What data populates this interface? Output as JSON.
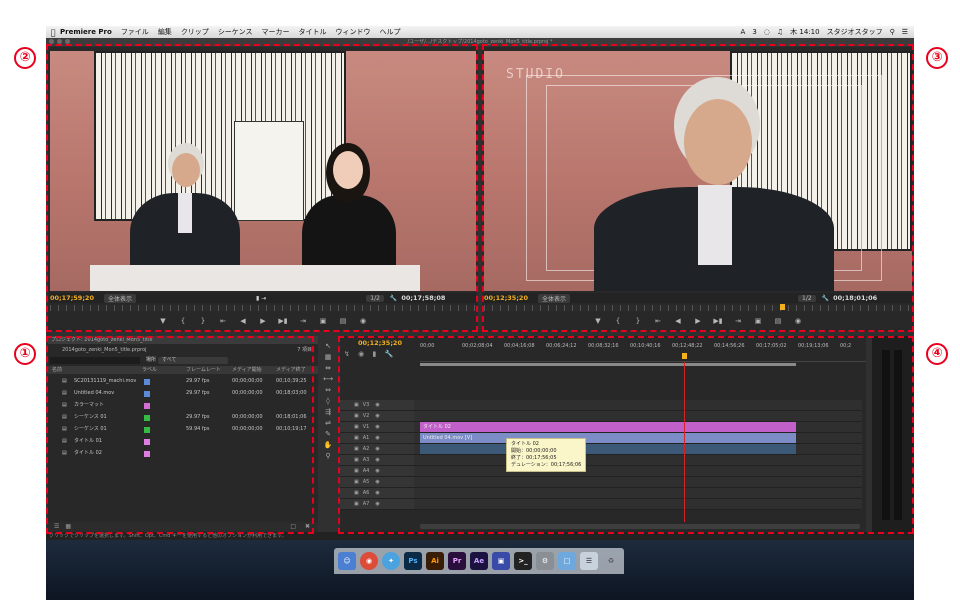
{
  "menubar": {
    "app_name": "Premiere Pro",
    "items": [
      "ファイル",
      "編集",
      "クリップ",
      "シーケンス",
      "マーカー",
      "タイトル",
      "ウィンドウ",
      "ヘルプ"
    ],
    "status": {
      "adobe": "3",
      "clock": "木 14:10",
      "user": "スタジオスタッフ"
    }
  },
  "window": {
    "title": "/ユーザ/.../デスクトップ/2014goto_zenki_Mon5_title.prproj *"
  },
  "source_monitor": {
    "timecode_in": "00;17;59;20",
    "fit": "全体表示",
    "resolution": "1/2",
    "timecode_out": "00;17;58;08"
  },
  "program_monitor": {
    "overlay_label": "STUDIO",
    "timecode_in": "00;12;35;20",
    "fit": "全体表示",
    "resolution": "1/2",
    "timecode_out": "00;18;01;06"
  },
  "project_panel": {
    "tab": "プロジェクト: 2014goto_zenki_Mon5_title",
    "file": "2014goto_zenki_Mon5_title.prproj",
    "count": "7 項目",
    "filter_label": "場所",
    "filter_value": "すべて",
    "columns": [
      "名前",
      "ラベル",
      "フレームレート",
      "メディア開始",
      "メディア終了"
    ],
    "rows": [
      {
        "name": "SC20131119_machi.mov",
        "fps": "29.97 fps",
        "start": "00;00;00;00",
        "end": "00;10;39;25",
        "color": "#5b8bd6"
      },
      {
        "name": "Untitled 04.mov",
        "fps": "29.97 fps",
        "start": "00;00;00;00",
        "end": "00;18;03;00",
        "color": "#5b8bd6"
      },
      {
        "name": "カラーマット",
        "fps": "",
        "start": "",
        "end": "",
        "color": "#d46fd2"
      },
      {
        "name": "シーケンス 01",
        "fps": "29.97 fps",
        "start": "00;00;00;00",
        "end": "00;18;01;06",
        "color": "#33bb44"
      },
      {
        "name": "シーケンス 01",
        "fps": "59.94 fps",
        "start": "00;00;00;00",
        "end": "00;10;19;17",
        "color": "#33bb44"
      },
      {
        "name": "タイトル 01",
        "fps": "",
        "start": "",
        "end": "",
        "color": "#e07ee0"
      },
      {
        "name": "タイトル 02",
        "fps": "",
        "start": "",
        "end": "",
        "color": "#e07ee0"
      }
    ]
  },
  "timeline": {
    "timecode": "00;12;35;20",
    "ruler": [
      "00;00",
      "00;02;08;04",
      "00;04;16;08",
      "00;06;24;12",
      "00;08;32;16",
      "00;10;40;16",
      "00;12;48;22",
      "00;14;56;26",
      "00;17;05;02",
      "00;19;13;06",
      "00;2"
    ],
    "tracks": [
      {
        "id": "V3"
      },
      {
        "id": "V2"
      },
      {
        "id": "V1"
      },
      {
        "id": "A1"
      },
      {
        "id": "A2"
      },
      {
        "id": "A3"
      },
      {
        "id": "A4"
      },
      {
        "id": "A5"
      },
      {
        "id": "A6"
      },
      {
        "id": "A7"
      }
    ],
    "clip_title": "タイトル 02",
    "clip_video": "Untitled 04.mov [V]",
    "tooltip": {
      "name": "タイトル 02",
      "start": "開始：00;00;00;00",
      "end": "終了：00;17;56;05",
      "duration": "デュレーション：00;17;56;06"
    }
  },
  "statusbar": {
    "text": "クリックでクリップを選択します。Shift、Opt、Cmd キーを使用すると他のオプションが利用できます。"
  },
  "annotations": {
    "one": "①",
    "two": "②",
    "three": "③",
    "four": "④"
  },
  "dock": {
    "icons": [
      "Finder",
      "Chrome",
      "Safari",
      "Ps",
      "Ai",
      "Pr",
      "Ae",
      "Utility",
      "Terminal",
      "Settings",
      "Folder",
      "Docs",
      "Trash"
    ]
  },
  "colors": {
    "timecode": "#f2b11e",
    "title_clip": "#c060c8",
    "video_clip": "#7c8cc6",
    "audio_clip": "#3c5a78",
    "playhead": "#d52424",
    "annotation": "#e8001c"
  }
}
